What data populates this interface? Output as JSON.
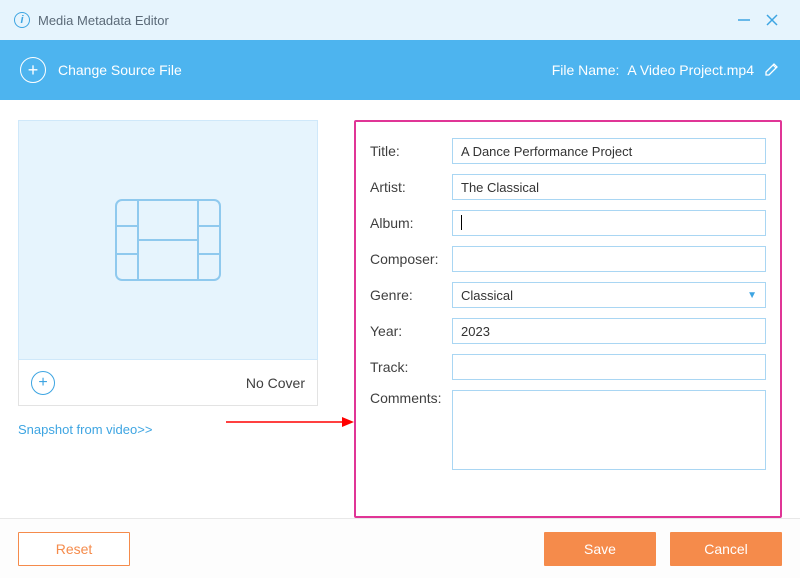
{
  "app": {
    "title": "Media Metadata Editor"
  },
  "sourceBar": {
    "changeLabel": "Change Source File",
    "fileNameLabel": "File Name:",
    "fileName": "A Video Project.mp4"
  },
  "cover": {
    "noCoverLabel": "No Cover",
    "snapshotLink": "Snapshot from video>>"
  },
  "form": {
    "labels": {
      "title": "Title:",
      "artist": "Artist:",
      "album": "Album:",
      "composer": "Composer:",
      "genre": "Genre:",
      "year": "Year:",
      "track": "Track:",
      "comments": "Comments:"
    },
    "values": {
      "title": "A Dance Performance Project",
      "artist": "The Classical",
      "album": "",
      "composer": "",
      "genre": "Classical",
      "year": "2023",
      "track": "",
      "comments": ""
    }
  },
  "footer": {
    "reset": "Reset",
    "save": "Save",
    "cancel": "Cancel"
  }
}
